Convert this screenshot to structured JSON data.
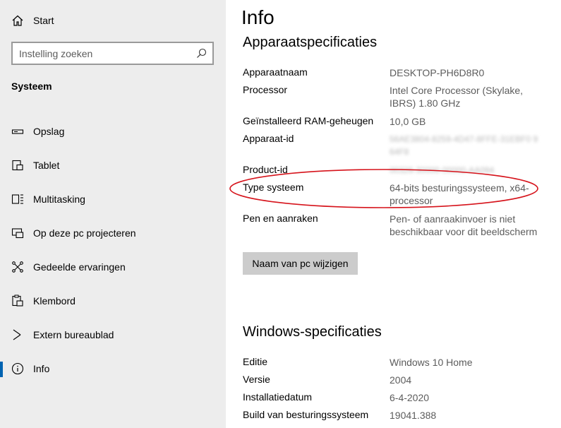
{
  "sidebar": {
    "home_label": "Start",
    "search_placeholder": "Instelling zoeken",
    "section_title": "Systeem",
    "items": [
      {
        "label": "Opslag",
        "icon": "storage-icon"
      },
      {
        "label": "Tablet",
        "icon": "tablet-icon"
      },
      {
        "label": "Multitasking",
        "icon": "multitasking-icon"
      },
      {
        "label": "Op deze pc projecteren",
        "icon": "project-icon"
      },
      {
        "label": "Gedeelde ervaringen",
        "icon": "shared-experiences-icon"
      },
      {
        "label": "Klembord",
        "icon": "clipboard-icon"
      },
      {
        "label": "Extern bureaublad",
        "icon": "remote-desktop-icon"
      },
      {
        "label": "Info",
        "icon": "info-icon",
        "active": true
      }
    ]
  },
  "main": {
    "title": "Info",
    "device_specs": {
      "heading": "Apparaatspecificaties",
      "rows": [
        {
          "key": "Apparaatnaam",
          "value": "DESKTOP-PH6D8R0"
        },
        {
          "key": "Processor",
          "value": "Intel Core Processor (Skylake, IBRS) 1.80 GHz"
        },
        {
          "key": "Geïnstalleerd RAM-geheugen",
          "value": "10,0 GB"
        },
        {
          "key": "Apparaat-id",
          "value": "56AE3804-8259-4D47-8FFE-31EBF0 964F8"
        },
        {
          "key": "Product-id",
          "value": "00326-30000-00000-AA094"
        },
        {
          "key": "Type systeem",
          "value": "64-bits besturingssysteem, x64-processor"
        },
        {
          "key": "Pen en aanraken",
          "value": "Pen- of aanraakinvoer is niet beschikbaar voor dit beeldscherm"
        }
      ],
      "rename_button": "Naam van pc wijzigen"
    },
    "windows_specs": {
      "heading": "Windows-specificaties",
      "rows": [
        {
          "key": "Editie",
          "value": "Windows 10 Home"
        },
        {
          "key": "Versie",
          "value": "2004"
        },
        {
          "key": "Installatiedatum",
          "value": "6-4-2020"
        },
        {
          "key": "Build van besturingssysteem",
          "value": "19041.388"
        }
      ]
    },
    "highlight_color": "#d6131b"
  }
}
